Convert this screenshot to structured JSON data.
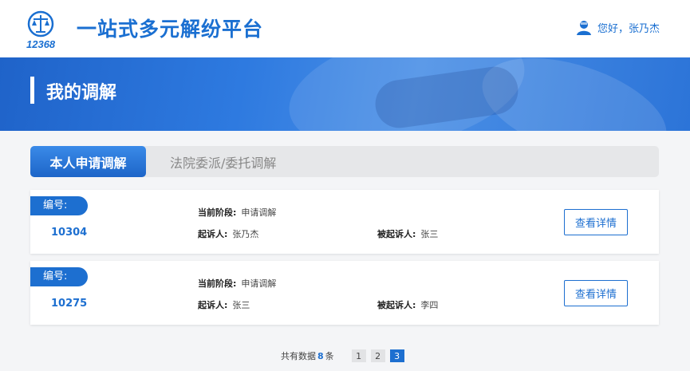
{
  "header": {
    "logo_text": "12368",
    "title": "一站式多元解纷平台",
    "user_greeting": "您好，张乃杰",
    "accent": "#1a6fd1"
  },
  "banner": {
    "title": "我的调解"
  },
  "tabs": [
    {
      "label": "本人申请调解",
      "active": true
    },
    {
      "label": "法院委派/委托调解",
      "active": false
    }
  ],
  "labels": {
    "number": "编号:",
    "stage": "当前阶段:",
    "plaintiff": "起诉人:",
    "defendant": "被起诉人:",
    "detail_button": "查看详情"
  },
  "cases": [
    {
      "number": "10304",
      "stage": "申请调解",
      "plaintiff": "张乃杰",
      "defendant": "张三"
    },
    {
      "number": "10275",
      "stage": "申请调解",
      "plaintiff": "张三",
      "defendant": "李四"
    }
  ],
  "pagination": {
    "prefix": "共有数据",
    "count": "8",
    "suffix": "条",
    "pages": [
      "1",
      "2",
      "3"
    ],
    "current": "3"
  }
}
